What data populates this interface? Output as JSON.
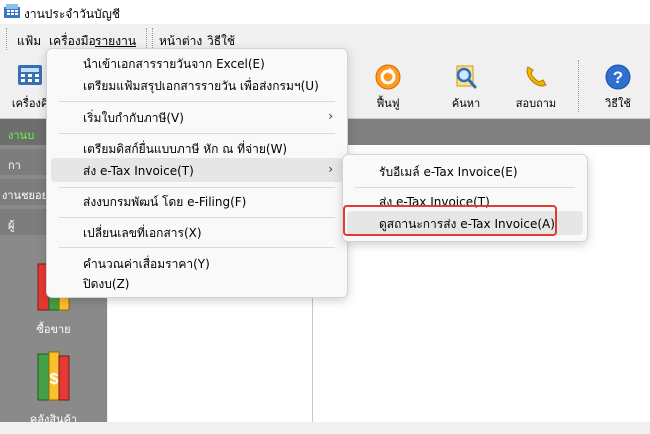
{
  "window": {
    "title": "งานประจำวันบัญชี"
  },
  "menubar": {
    "items": [
      "แฟ้ม",
      "เครื่องมือ",
      "รายงาน",
      "หน้าต่าง",
      "วิธีใช้"
    ]
  },
  "toolbar": {
    "buttons": [
      {
        "label": "เครื่องคิ",
        "icon": "calculator-icon"
      },
      {
        "label": "ฟื้นฟู",
        "icon": "restore-icon"
      },
      {
        "label": "ค้นหา",
        "icon": "search-icon"
      },
      {
        "label": "สอบถาม",
        "icon": "phone-icon"
      },
      {
        "label": "วิธีใช้",
        "icon": "help-icon"
      }
    ]
  },
  "sidebar": {
    "headers": [
      "งานบ",
      "กา",
      "งานชยอย",
      "ผู้"
    ],
    "tiles": [
      {
        "label": "ซื้อขาย",
        "icon": "books-icon"
      },
      {
        "label": "คลังสินค้า",
        "icon": "inventory-icon"
      }
    ]
  },
  "file_menu": {
    "items": [
      {
        "label": "นำเข้าเอกสารรายวันจาก Excel(E)"
      },
      {
        "label": "เตรียมแฟ้มสรุปเอกสารรายวัน เพื่อส่งกรมฯ(U)"
      },
      {
        "label": "เริ่มใบกำกับภาษี(V)",
        "arrow": "›"
      },
      {
        "label": "เตรียมดิสก์ยื่นแบบภาษี หัก ณ ที่จ่าย(W)"
      },
      {
        "label": "ส่ง e-Tax Invoice(T)",
        "arrow": "›"
      },
      {
        "label": "ส่งงบกรมพัฒน์ โดย e-Filing(F)"
      },
      {
        "label": "เปลี่ยนเลขที่เอกสาร(X)"
      },
      {
        "label": "คำนวณค่าเสื่อมราคา(Y)"
      },
      {
        "label": "ปิดงบ(Z)"
      }
    ]
  },
  "submenu": {
    "items": [
      {
        "label": "รับอีเมล์ e-Tax Invoice(E)"
      },
      {
        "label": "ส่ง e-Tax Invoice(T)"
      },
      {
        "label": "ดูสถานะการส่ง e-Tax Invoice(A)"
      }
    ]
  },
  "colors": {
    "highlight": "#e53935",
    "sidebar": "#8a8a8a"
  }
}
